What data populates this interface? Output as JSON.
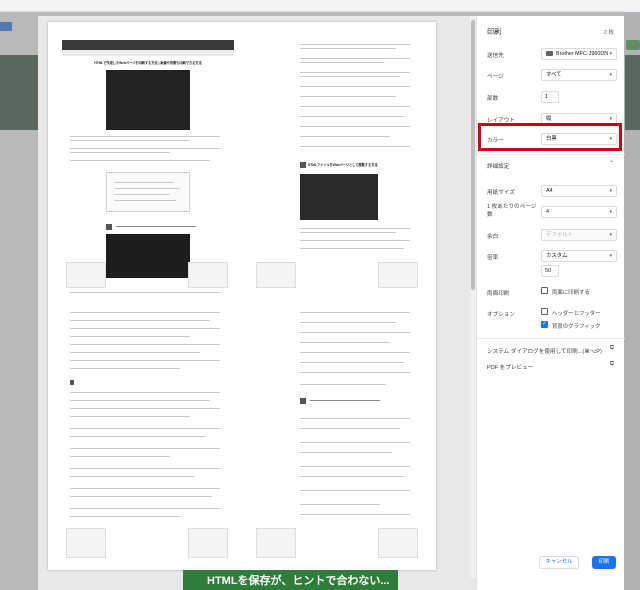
{
  "colors": {
    "accent": "#1a73e8",
    "highlight": "#d0021b",
    "site_green": "#2f7d3a"
  },
  "panel": {
    "title": "印刷",
    "sheet_count": "2 枚",
    "destination": {
      "label": "送信先",
      "value": "Brother MFC-J960DN"
    },
    "pages": {
      "label": "ページ",
      "value": "すべて"
    },
    "copies": {
      "label": "部数",
      "value": "1"
    },
    "layout": {
      "label": "レイアウト",
      "value": "縦"
    },
    "color": {
      "label": "カラー",
      "value": "白黒"
    },
    "more_settings": {
      "label": "詳細設定"
    },
    "paper_size": {
      "label": "用紙サイズ",
      "value": "A4"
    },
    "pages_per_sheet": {
      "label_line1": "1 枚あたりのページ",
      "label_line2": "数",
      "value": "4"
    },
    "margins": {
      "label": "余白",
      "value": "デフォルト"
    },
    "scale": {
      "label": "倍率",
      "value": "カスタム",
      "custom_value": "50"
    },
    "two_sided": {
      "label": "両面印刷",
      "option": "両面に印刷する"
    },
    "options": {
      "label": "オプション",
      "headers_footers": "ヘッダーとフッター",
      "background_graphics": "背景のグラフィック"
    },
    "system_dialog": "システム ダイアログを使用して印刷...(⌘⌥P)",
    "pdf_preview": "PDF をプレビュー",
    "cancel": "キャンセル",
    "print": "印刷"
  },
  "preview": {
    "page1_title": "HTMLで作成したWebページを印刷する方法 | 画像や背景も印刷できる方法",
    "page2_heading": "HTMLファイルをWebページとして閲覧する方法",
    "bottom_banner": "HTMLを保存が、ヒントで合わない..."
  }
}
